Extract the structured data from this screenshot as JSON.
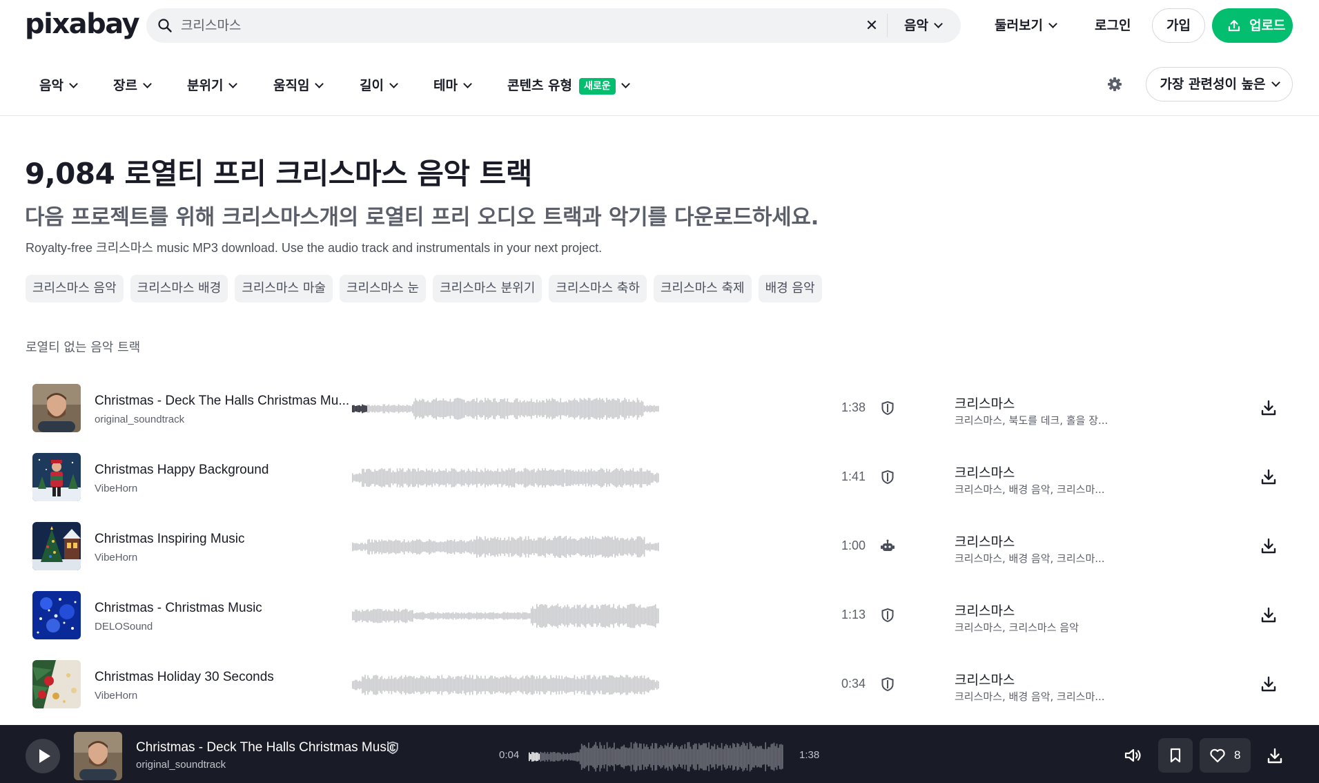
{
  "header": {
    "logo": "pixabay",
    "search_value": "크리스마스",
    "search_type": "음악",
    "explore": "둘러보기",
    "login": "로그인",
    "signup": "가입",
    "upload": "업로드"
  },
  "filters": {
    "items": [
      "음악",
      "장르",
      "분위기",
      "움직임",
      "길이",
      "테마",
      "콘텐츠 유형"
    ],
    "new_badge": "새로운",
    "sort": "가장 관련성이 높은"
  },
  "page": {
    "title": "9,084 로열티 프리 크리스마스 음악 트랙",
    "subtitle": "다음 프로젝트를 위해 크리스마스개의 로열티 프리 오디오 트랙과 악기를 다운로드하세요.",
    "description": "Royalty-free 크리스마스 music MP3 download. Use the audio track and instrumentals in your next project.",
    "tags": [
      "크리스마스 음악",
      "크리스마스 배경",
      "크리스마스 마술",
      "크리스마스 눈",
      "크리스마스 분위기",
      "크리스마스 축하",
      "크리스마스 축제",
      "배경 음악"
    ],
    "section_label": "로열티 없는 음악 트랙"
  },
  "tracks": [
    {
      "title": "Christmas - Deck The Halls Christmas Mu...",
      "author": "original_soundtrack",
      "duration": "1:38",
      "license_icon": "shield-icon",
      "category": "크리스마스",
      "tags": "크리스마스, 북도를 데크, 홀을 장...",
      "playing": true
    },
    {
      "title": "Christmas Happy Background",
      "author": "VibeHorn",
      "duration": "1:41",
      "license_icon": "shield-icon",
      "category": "크리스마스",
      "tags": "크리스마스, 배경 음악, 크리스마...",
      "playing": false
    },
    {
      "title": "Christmas Inspiring Music",
      "author": "VibeHorn",
      "duration": "1:00",
      "license_icon": "robot-icon",
      "category": "크리스마스",
      "tags": "크리스마스, 배경 음악, 크리스마...",
      "playing": false
    },
    {
      "title": "Christmas - Christmas Music",
      "author": "DELOSound",
      "duration": "1:13",
      "license_icon": "shield-icon",
      "category": "크리스마스",
      "tags": "크리스마스, 크리스마스 음악",
      "playing": false
    },
    {
      "title": "Christmas Holiday 30 Seconds",
      "author": "VibeHorn",
      "duration": "0:34",
      "license_icon": "shield-icon",
      "category": "크리스마스",
      "tags": "크리스마스, 배경 음악, 크리스마...",
      "playing": false
    }
  ],
  "player": {
    "title": "Christmas - Deck The Halls Christmas Music",
    "author": "original_soundtrack",
    "current_time": "0:04",
    "total_time": "1:38",
    "progress": 0.04,
    "likes": "8"
  },
  "colors": {
    "accent": "#02be6e",
    "text": "#191b26",
    "muted": "#5b5f6a",
    "chip_bg": "#f1f2f4",
    "player_bg": "#191b26",
    "waveform": "#c8c9cc"
  }
}
